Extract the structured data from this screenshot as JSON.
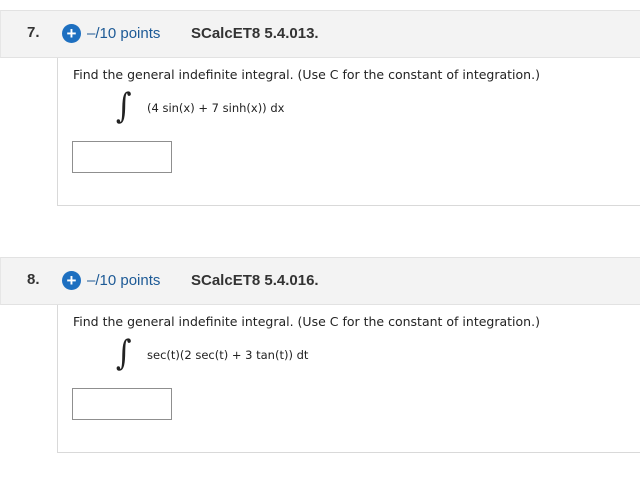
{
  "questions": [
    {
      "number": "7.",
      "plus_icon": "+",
      "points": "–/10 points",
      "source": "SCalcET8 5.4.013.",
      "prompt": "Find the general indefinite integral. (Use C for the constant of integration.)",
      "integral_symbol": "∫",
      "integrand": "(4 sin(x) + 7 sinh(x)) dx",
      "answer_value": ""
    },
    {
      "number": "8.",
      "plus_icon": "+",
      "points": "–/10 points",
      "source": "SCalcET8 5.4.016.",
      "prompt": "Find the general indefinite integral. (Use C for the constant of integration.)",
      "integral_symbol": "∫",
      "integrand": "sec(t)(2 sec(t) + 3 tan(t)) dt",
      "answer_value": ""
    }
  ],
  "colors": {
    "accent": "#1d6fc0",
    "points_text": "#1d5a96",
    "header_bg": "#f3f3f3"
  }
}
